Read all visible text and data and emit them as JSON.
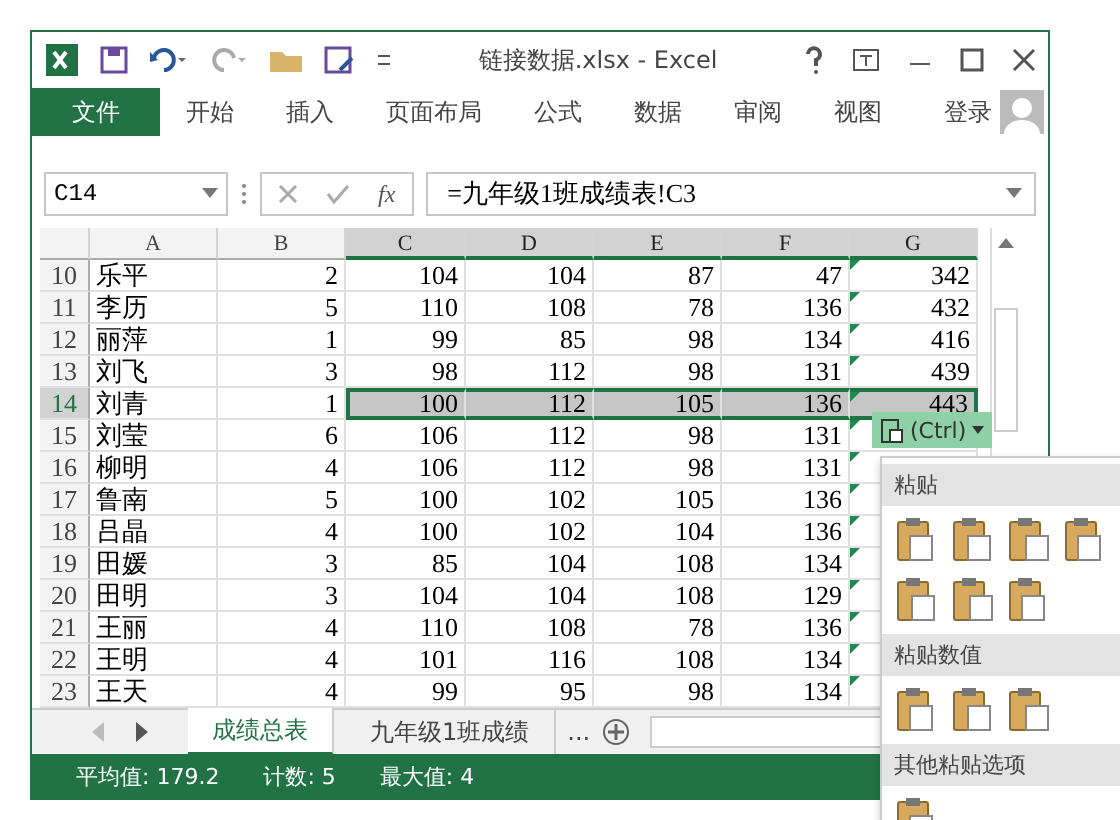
{
  "window": {
    "title": "链接数据.xlsx - Excel"
  },
  "ribbon": {
    "tabs": [
      {
        "label": "文件",
        "kind": "file",
        "selected": false
      },
      {
        "label": "开始",
        "kind": "tab",
        "selected": false
      },
      {
        "label": "插入",
        "kind": "tab",
        "selected": false
      },
      {
        "label": "页面布局",
        "kind": "tab",
        "selected": false
      },
      {
        "label": "公式",
        "kind": "tab",
        "selected": false
      },
      {
        "label": "数据",
        "kind": "tab",
        "selected": false
      },
      {
        "label": "审阅",
        "kind": "tab",
        "selected": false
      },
      {
        "label": "视图",
        "kind": "tab",
        "selected": false
      }
    ],
    "login": "登录"
  },
  "formula_bar": {
    "name_box": "C14",
    "fx": "fx",
    "formula": "=九年级1班成绩表!C3"
  },
  "sheet": {
    "columns": [
      {
        "label": "A",
        "selected": false
      },
      {
        "label": "B",
        "selected": false
      },
      {
        "label": "C",
        "selected": true
      },
      {
        "label": "D",
        "selected": true
      },
      {
        "label": "E",
        "selected": true
      },
      {
        "label": "F",
        "selected": true
      },
      {
        "label": "G",
        "selected": true
      }
    ],
    "rows": [
      {
        "header": "10",
        "selected": false,
        "cells": [
          "乐平",
          "2",
          "104",
          "104",
          "87",
          "47",
          "342"
        ]
      },
      {
        "header": "11",
        "selected": false,
        "cells": [
          "李历",
          "5",
          "110",
          "108",
          "78",
          "136",
          "432"
        ]
      },
      {
        "header": "12",
        "selected": false,
        "cells": [
          "丽萍",
          "1",
          "99",
          "85",
          "98",
          "134",
          "416"
        ]
      },
      {
        "header": "13",
        "selected": false,
        "cells": [
          "刘飞",
          "3",
          "98",
          "112",
          "98",
          "131",
          "439"
        ]
      },
      {
        "header": "14",
        "selected": true,
        "cells": [
          "刘青",
          "1",
          "100",
          "112",
          "105",
          "136",
          "443"
        ]
      },
      {
        "header": "15",
        "selected": false,
        "cells": [
          "刘莹",
          "6",
          "106",
          "112",
          "98",
          "131",
          ""
        ]
      },
      {
        "header": "16",
        "selected": false,
        "cells": [
          "柳明",
          "4",
          "106",
          "112",
          "98",
          "131",
          ""
        ]
      },
      {
        "header": "17",
        "selected": false,
        "cells": [
          "鲁南",
          "5",
          "100",
          "102",
          "105",
          "136",
          ""
        ]
      },
      {
        "header": "18",
        "selected": false,
        "cells": [
          "吕晶",
          "4",
          "100",
          "102",
          "104",
          "136",
          ""
        ]
      },
      {
        "header": "19",
        "selected": false,
        "cells": [
          "田媛",
          "3",
          "85",
          "104",
          "108",
          "134",
          ""
        ]
      },
      {
        "header": "20",
        "selected": false,
        "cells": [
          "田明",
          "3",
          "104",
          "104",
          "108",
          "129",
          ""
        ]
      },
      {
        "header": "21",
        "selected": false,
        "cells": [
          "王丽",
          "4",
          "110",
          "108",
          "78",
          "136",
          ""
        ]
      },
      {
        "header": "22",
        "selected": false,
        "cells": [
          "王明",
          "4",
          "101",
          "116",
          "108",
          "134",
          ""
        ]
      },
      {
        "header": "23",
        "selected": false,
        "cells": [
          "王天",
          "4",
          "99",
          "95",
          "98",
          "134",
          ""
        ]
      }
    ]
  },
  "sheet_tabs": [
    {
      "label": "成绩总表",
      "selected": true
    },
    {
      "label": "九年级1班成绩",
      "selected": false
    }
  ],
  "sheet_tabs_more": "...",
  "status_bar": [
    "平均值: 179.2",
    "计数: 5",
    "最大值: 4"
  ],
  "paste_options": {
    "button": "(Ctrl)",
    "sections": [
      {
        "title": "粘贴"
      },
      {
        "title": "粘贴数值"
      },
      {
        "title": "其他粘贴选项"
      }
    ]
  }
}
